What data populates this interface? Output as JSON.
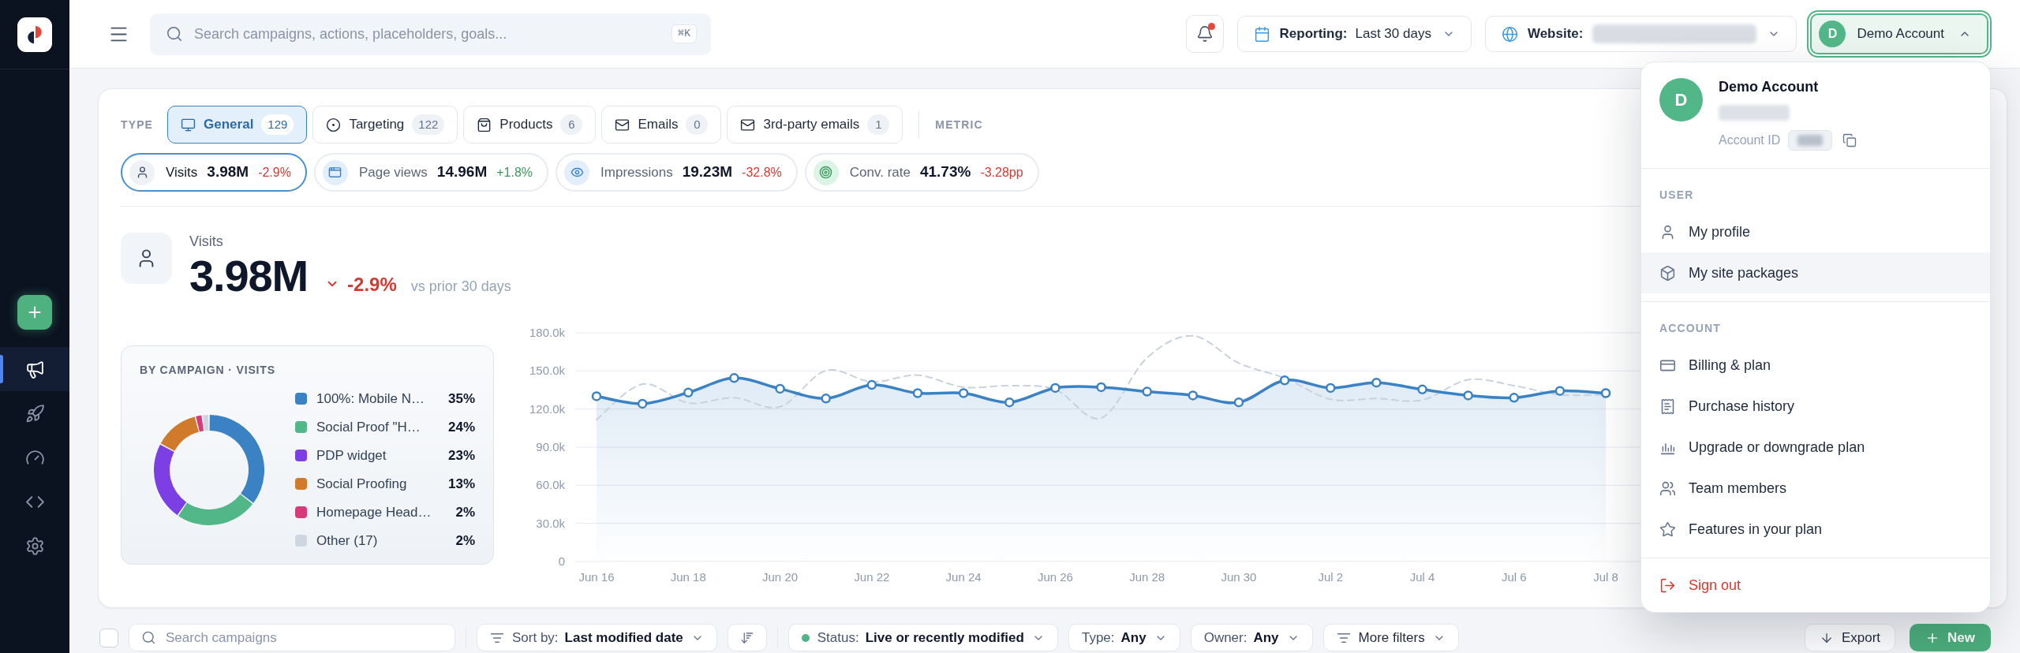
{
  "sidebar": {
    "nav": [
      {
        "selected": true
      },
      {
        "selected": false
      },
      {
        "selected": false
      },
      {
        "selected": false
      },
      {
        "selected": false
      }
    ]
  },
  "top_bar": {
    "search": {
      "placeholder": "Search campaigns, actions, placeholders, goals...",
      "shortcut": "⌘K"
    },
    "notifications": {
      "unread": true
    },
    "reporting": {
      "label": "Reporting:",
      "value": "Last 30 days"
    },
    "website": {
      "label": "Website:"
    },
    "account": {
      "initial": "D",
      "name": "Demo Account",
      "expanded": true
    }
  },
  "type_filter": {
    "label": "TYPE",
    "tabs": [
      {
        "label": "General",
        "count": "129",
        "selected": true
      },
      {
        "label": "Targeting",
        "count": "122",
        "selected": false
      },
      {
        "label": "Products",
        "count": "6",
        "selected": false
      },
      {
        "label": "Emails",
        "count": "0",
        "selected": false
      },
      {
        "label": "3rd-party emails",
        "count": "1",
        "selected": false
      }
    ],
    "metric_label": "METRIC"
  },
  "metrics": [
    {
      "label": "Visits",
      "value": "3.98M",
      "delta": "-2.9%",
      "decrease": true,
      "selected": true
    },
    {
      "label": "Page views",
      "value": "14.96M",
      "delta": "+1.8%",
      "decrease": false,
      "selected": false
    },
    {
      "label": "Impressions",
      "value": "19.23M",
      "delta": "-32.8%",
      "decrease": true,
      "selected": false
    },
    {
      "label": "Conv. rate",
      "value": "41.73%",
      "delta": "-3.28pp",
      "decrease": true,
      "selected": false
    }
  ],
  "summary": {
    "label": "Visits",
    "value": "3.98M",
    "delta": "-2.9%",
    "decrease": true,
    "comparison": "vs prior 30 days"
  },
  "breakdown": {
    "title": "BY CAMPAIGN · VISITS",
    "chart_data": {
      "type": "donut",
      "categories": [
        "100%: Mobile N…",
        "Social Proof \"H…",
        "PDP widget",
        "Social Proofing",
        "Homepage Head…",
        "Other (17)"
      ],
      "series": [
        {
          "values": [
            35,
            24,
            23,
            13,
            2,
            2
          ]
        }
      ]
    },
    "legend": [
      {
        "share": "35%",
        "color": "#3b82c4"
      },
      {
        "share": "24%",
        "color": "#52b788"
      },
      {
        "share": "23%",
        "color": "#7b3fe4"
      },
      {
        "share": "13%",
        "color": "#d07a2c"
      },
      {
        "share": "2%",
        "color": "#d63a78"
      },
      {
        "share": "2%",
        "color": "#cfd6e0"
      }
    ]
  },
  "trend_chart": {
    "chart_data": {
      "type": "area",
      "grid": true,
      "categories": [
        "Jun 16",
        null,
        "Jun 18",
        null,
        "Jun 20",
        null,
        "Jun 22",
        null,
        "Jun 24",
        null,
        "Jun 26",
        null,
        "Jun 28",
        null,
        "Jun 30",
        null,
        "Jul 2",
        null,
        "Jul 4",
        null,
        "Jul 6",
        null,
        "Jul 8"
      ],
      "ylim": [
        0,
        180000
      ],
      "yticks": [
        {
          "value": 0,
          "label": "0"
        },
        {
          "value": 30000,
          "label": "30.0k"
        },
        {
          "value": 60000,
          "label": "60.0k"
        },
        {
          "value": 90000,
          "label": "90.0k"
        },
        {
          "value": 120000,
          "label": "120.0k"
        },
        {
          "value": 150000,
          "label": "150.0k"
        },
        {
          "value": 180000,
          "label": "180.0k"
        }
      ],
      "series": [
        {
          "color": "#3b82c4",
          "line_style": "solid",
          "marker": "circle",
          "values": [
            130100,
            124200,
            133000,
            144400,
            136000,
            128300,
            139000,
            132500,
            132500,
            125300,
            136600,
            137200,
            133700,
            130700,
            125300,
            142600,
            136600,
            140800,
            135400,
            130700,
            128900,
            134300,
            132500
          ]
        },
        {
          "type": "line",
          "color": "#c9d1dc",
          "line_style": "dashed",
          "values": [
            111700,
            139600,
            124800,
            128900,
            121800,
            150300,
            141400,
            146700,
            137200,
            138400,
            135400,
            112900,
            160400,
            177600,
            156200,
            144400,
            127700,
            128300,
            127100,
            143100,
            138400,
            131300,
            131300
          ]
        }
      ]
    }
  },
  "toolbar": {
    "select_all": {
      "checked": false
    },
    "search": {
      "placeholder": "Search campaigns"
    },
    "sort": {
      "label": "Sort by:",
      "value": "Last modified date"
    },
    "filters": [
      {
        "kind": "status",
        "label": "Status:",
        "value": "Live or recently modified"
      },
      {
        "kind": "select",
        "label": "Type:",
        "value": "Any"
      },
      {
        "kind": "select",
        "label": "Owner:",
        "value": "Any"
      },
      {
        "kind": "more",
        "label": "More filters"
      }
    ],
    "export": "Export",
    "new": "New"
  },
  "account_menu": {
    "initial": "D",
    "name": "Demo Account",
    "account_id_label": "Account ID",
    "sections": [
      {
        "title": "USER",
        "items": [
          {
            "label": "My profile",
            "highlighted": false
          },
          {
            "label": "My site packages",
            "highlighted": true
          }
        ]
      },
      {
        "title": "ACCOUNT",
        "items": [
          {
            "label": "Billing & plan",
            "highlighted": false
          },
          {
            "label": "Purchase history",
            "highlighted": false
          },
          {
            "label": "Upgrade or downgrade plan",
            "highlighted": false
          },
          {
            "label": "Team members",
            "highlighted": false
          },
          {
            "label": "Features in your plan",
            "highlighted": false
          }
        ]
      }
    ],
    "sign_out": "Sign out"
  }
}
